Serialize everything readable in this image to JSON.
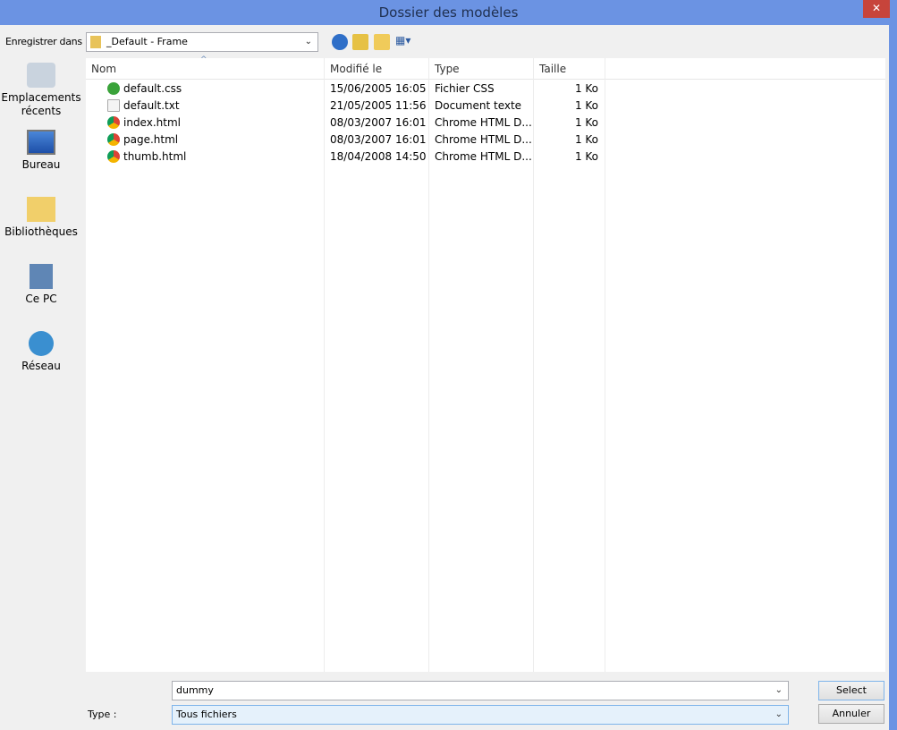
{
  "window": {
    "title": "Dossier des modèles",
    "close": "✕"
  },
  "toolbar": {
    "save_in_label": "Enregistrer dans :",
    "location": "_Default - Frame"
  },
  "places": [
    {
      "label": "Emplacements récents"
    },
    {
      "label": "Bureau"
    },
    {
      "label": "Bibliothèques"
    },
    {
      "label": "Ce PC"
    },
    {
      "label": "Réseau"
    }
  ],
  "columns": {
    "name": "Nom",
    "modified": "Modifié le",
    "type": "Type",
    "size": "Taille"
  },
  "files": [
    {
      "name": "default.css",
      "modified": "15/06/2005 16:05",
      "type": "Fichier CSS",
      "size": "1 Ko",
      "icon": "css-file"
    },
    {
      "name": "default.txt",
      "modified": "21/05/2005 11:56",
      "type": "Document texte",
      "size": "1 Ko",
      "icon": "text-file"
    },
    {
      "name": "index.html",
      "modified": "08/03/2007 16:01",
      "type": "Chrome HTML D...",
      "size": "1 Ko",
      "icon": "chrome"
    },
    {
      "name": "page.html",
      "modified": "08/03/2007 16:01",
      "type": "Chrome HTML D...",
      "size": "1 Ko",
      "icon": "chrome"
    },
    {
      "name": "thumb.html",
      "modified": "18/04/2008 14:50",
      "type": "Chrome HTML D...",
      "size": "1 Ko",
      "icon": "chrome"
    }
  ],
  "bottom": {
    "filename": "dummy",
    "type_label": "Type :",
    "type_value": "Tous fichiers",
    "select": "Select",
    "cancel": "Annuler"
  }
}
